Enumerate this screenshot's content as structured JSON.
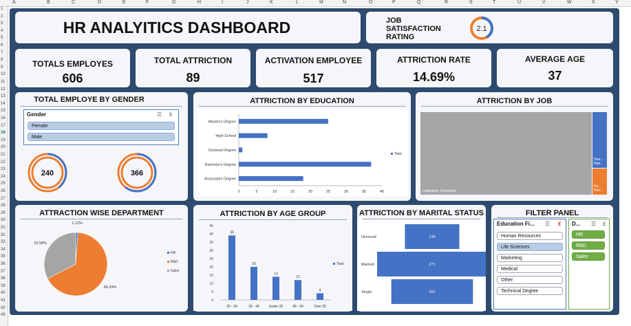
{
  "sheet": {
    "columns": [
      "A",
      "B",
      "C",
      "D",
      "E",
      "F",
      "G",
      "H",
      "I",
      "J",
      "K",
      "L",
      "M",
      "N",
      "O",
      "P",
      "Q",
      "R",
      "S",
      "T",
      "U",
      "V",
      "W",
      "X",
      "Y"
    ],
    "rows": [
      "1",
      "2",
      "3",
      "4",
      "5",
      "6",
      "7",
      "8",
      "9",
      "10",
      "11",
      "12",
      "13",
      "14",
      "15",
      "16",
      "17",
      "18",
      "19",
      "20",
      "21",
      "22",
      "23",
      "24",
      "25",
      "26",
      "27",
      "28",
      "29",
      "30",
      "31",
      "32",
      "33",
      "34",
      "35",
      "36",
      "37",
      "38",
      "39",
      "40",
      "41",
      "42",
      "43"
    ],
    "selected_row": "18"
  },
  "header": {
    "title": "HR ANALYITICS DASHBOARD"
  },
  "job_satisfaction": {
    "label_line1": "JOB",
    "label_line2": "SATISFACTION",
    "label_line3": "RATING",
    "value": "2.1",
    "fraction": 0.42
  },
  "kpis": [
    {
      "label": "TOTALS EMPLOYES",
      "value": "606"
    },
    {
      "label": "TOTAL ATTRICTION",
      "value": "89"
    },
    {
      "label": "ACTIVATION EMPLOYEE",
      "value": "517"
    },
    {
      "label": "ATTRICTION RATE",
      "value": "14.69%"
    },
    {
      "label": "AVERAGE AGE",
      "value": "37"
    }
  ],
  "gender_panel": {
    "title": "TOTAL EMPLOYE BY GENDER",
    "slicer_header": "Gender",
    "items": [
      "Female",
      "Male"
    ],
    "female_value": "240",
    "male_value": "366",
    "female_fraction": 0.396,
    "male_fraction": 0.604
  },
  "education_panel": {
    "title": "ATTRICTION BY EDUCATION"
  },
  "job_panel": {
    "title": "ATTRICTION BY JOB",
    "big_label": "Laboratory Technician",
    "small_label1": "Hea... Rep...",
    "small_label2": "Hu... Res..."
  },
  "dept_panel": {
    "title": "ATTRACTION WISE DEPARTMENT"
  },
  "age_panel": {
    "title": "ATTRICTION BY AGE GROUP"
  },
  "marital_panel": {
    "title": "ATTRICTION BY MARITAL STATUS"
  },
  "filter_panel": {
    "title": "FILTER PANEL",
    "education_header": "Education Fi...",
    "education_items": [
      "Human Resources",
      "Life Sciences",
      "Marketing",
      "Medical",
      "Other",
      "Technical Degree"
    ],
    "education_selected": "Life Sciences",
    "dept_header": "D...",
    "dept_items": [
      "HR",
      "R&D",
      "Sales"
    ]
  },
  "colors": {
    "blue": "#4472c4",
    "orange": "#ed7d31",
    "gray": "#a5a5a5",
    "navy": "#2e4a6e"
  },
  "chart_data": [
    {
      "type": "bar",
      "orientation": "horizontal",
      "title": "ATTRICTION BY EDUCATION",
      "categories": [
        "Master's Degree",
        "High School",
        "Doctoral Degree",
        "Bachelor's Degree",
        "Associates Degree"
      ],
      "series": [
        {
          "name": "Total",
          "values": [
            25,
            8,
            1,
            37,
            18
          ]
        }
      ],
      "xlim": [
        0,
        40
      ],
      "xticks": [
        "0",
        "5",
        "10",
        "15",
        "20",
        "25",
        "30",
        "35",
        "40"
      ],
      "legend": "right"
    },
    {
      "type": "pie",
      "title": "ATTRACTION WISE DEPARTMENT",
      "categories": [
        "HR",
        "R&D",
        "Sales"
      ],
      "values": [
        1.12,
        66.29,
        32.58
      ],
      "labels": [
        "1.12%",
        "66.29%",
        "32.58%"
      ],
      "legend": "right"
    },
    {
      "type": "bar",
      "title": "ATTRICTION BY AGE GROUP",
      "categories": [
        "25 - 34",
        "35 - 44",
        "Under 25",
        "45 - 54",
        "Over 55"
      ],
      "series": [
        {
          "name": "Total",
          "values": [
            39,
            20,
            14,
            12,
            4
          ]
        }
      ],
      "ylim": [
        0,
        45
      ],
      "yticks": [
        "0",
        "5",
        "10",
        "15",
        "20",
        "25",
        "30",
        "35",
        "40",
        "45"
      ],
      "legend": "right"
    },
    {
      "type": "bar",
      "orientation": "funnel",
      "title": "ATTRICTION BY MARITAL STATUS",
      "categories": [
        "Divorced",
        "Married",
        "Single"
      ],
      "values": [
        134,
        271,
        201
      ]
    },
    {
      "type": "treemap",
      "title": "ATTRICTION BY JOB",
      "categories": [
        "Laboratory Technician",
        "Healthcare Representative",
        "Human Resources"
      ]
    }
  ]
}
